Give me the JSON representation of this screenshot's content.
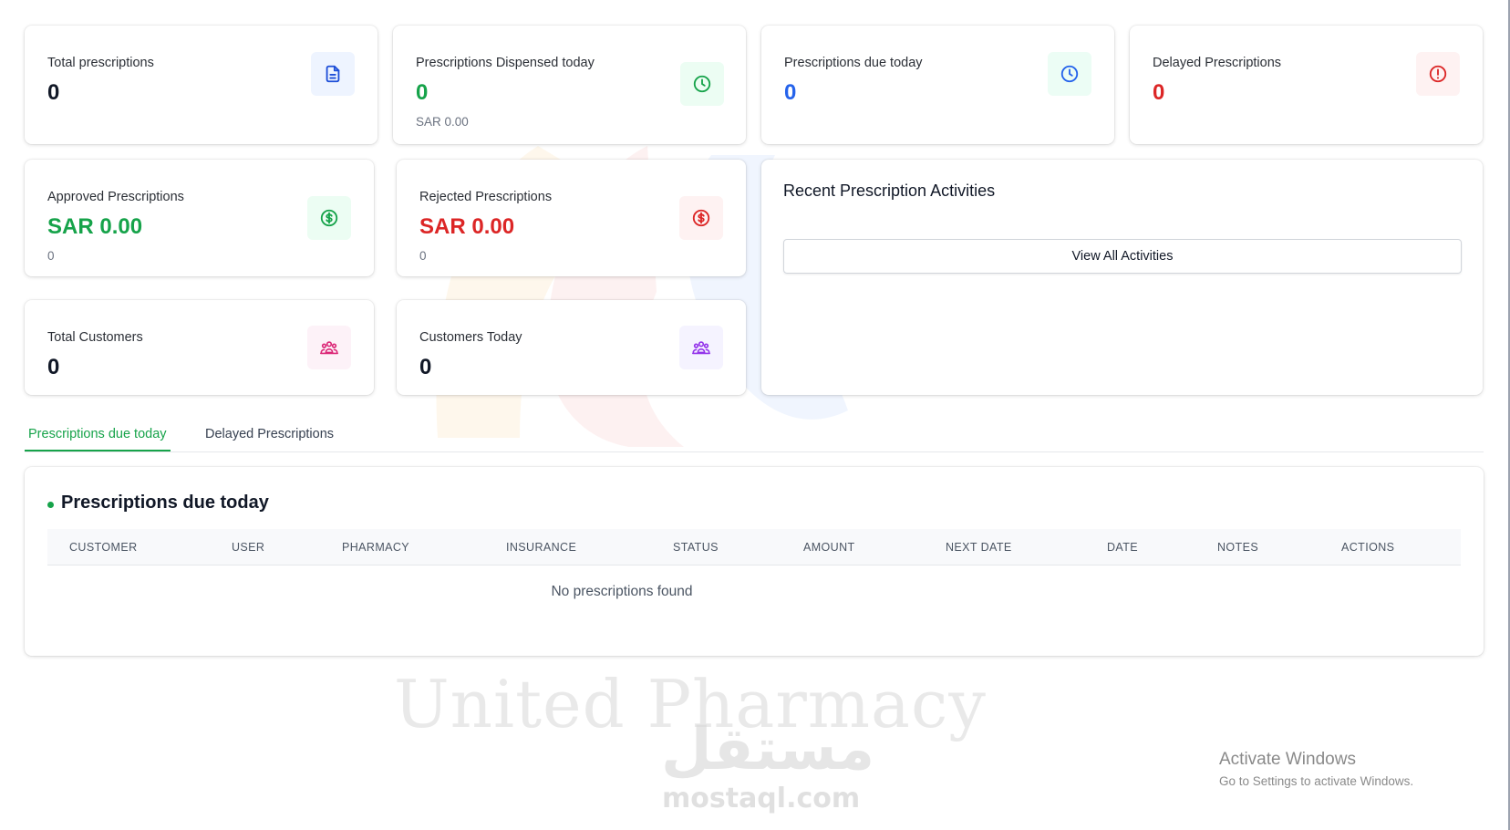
{
  "watermark": {
    "brand": "United Pharmacy",
    "arabic": "مستقل",
    "site": "mostaql.com"
  },
  "stats": {
    "total_prescriptions": {
      "label": "Total prescriptions",
      "value": "0",
      "icon": "document-icon",
      "color": "#1d4ed8",
      "bg": "#eef4ff"
    },
    "dispensed_today": {
      "label": "Prescriptions Dispensed today",
      "value": "0",
      "sub": "SAR 0.00",
      "icon": "clock-icon",
      "color": "#16a34a",
      "bg": "#ecfdf3"
    },
    "due_today": {
      "label": "Prescriptions due today",
      "value": "0",
      "icon": "clock-icon",
      "color": "#2563eb",
      "bg": "#ecfdf5"
    },
    "delayed": {
      "label": "Delayed Prescriptions",
      "value": "0",
      "icon": "alert-circle-icon",
      "color": "#dc2626",
      "bg": "#fef2f2"
    },
    "approved": {
      "label": "Approved Prescriptions",
      "value": "SAR 0.00",
      "sub": "0",
      "icon": "dollar-circle-icon",
      "color": "#16a34a",
      "bg": "#ecfdf3"
    },
    "rejected": {
      "label": "Rejected Prescriptions",
      "value": "SAR 0.00",
      "sub": "0",
      "icon": "dollar-circle-icon",
      "color": "#dc2626",
      "bg": "#fef2f2"
    },
    "total_customers": {
      "label": "Total Customers",
      "value": "0",
      "icon": "users-icon",
      "color": "#db2777",
      "bg": "#fdf2f8"
    },
    "customers_today": {
      "label": "Customers Today",
      "value": "0",
      "icon": "users-icon",
      "color": "#9333ea",
      "bg": "#f5f3ff"
    }
  },
  "activities": {
    "title": "Recent Prescription Activities",
    "button": "View All Activities"
  },
  "tabs": [
    {
      "label": "Prescriptions due today",
      "active": true
    },
    {
      "label": "Delayed Prescriptions",
      "active": false
    }
  ],
  "table": {
    "title": "Prescriptions due today",
    "columns": [
      "CUSTOMER",
      "USER",
      "PHARMACY",
      "INSURANCE",
      "STATUS",
      "AMOUNT",
      "NEXT DATE",
      "DATE",
      "NOTES",
      "ACTIONS"
    ],
    "empty_text": "No prescriptions found"
  },
  "windows_notice": {
    "title": "Activate Windows",
    "subtitle": "Go to Settings to activate Windows."
  },
  "colors": {
    "accent_green": "#16a34a",
    "blue": "#2563eb",
    "red": "#dc2626",
    "dark": "#111827"
  }
}
